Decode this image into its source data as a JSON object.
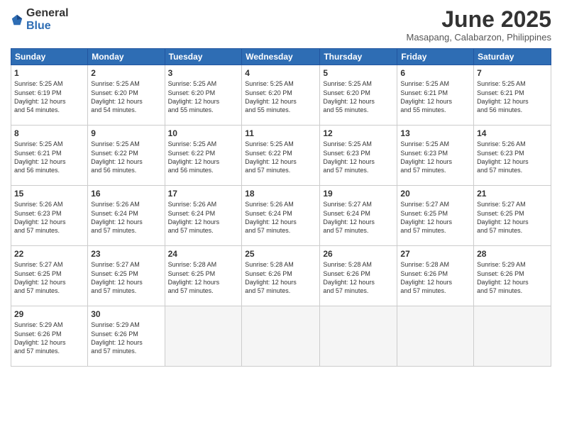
{
  "header": {
    "logo_general": "General",
    "logo_blue": "Blue",
    "month_title": "June 2025",
    "location": "Masapang, Calabarzon, Philippines"
  },
  "days_of_week": [
    "Sunday",
    "Monday",
    "Tuesday",
    "Wednesday",
    "Thursday",
    "Friday",
    "Saturday"
  ],
  "weeks": [
    [
      {
        "num": "1",
        "info": "Sunrise: 5:25 AM\nSunset: 6:19 PM\nDaylight: 12 hours\nand 54 minutes."
      },
      {
        "num": "2",
        "info": "Sunrise: 5:25 AM\nSunset: 6:20 PM\nDaylight: 12 hours\nand 54 minutes."
      },
      {
        "num": "3",
        "info": "Sunrise: 5:25 AM\nSunset: 6:20 PM\nDaylight: 12 hours\nand 55 minutes."
      },
      {
        "num": "4",
        "info": "Sunrise: 5:25 AM\nSunset: 6:20 PM\nDaylight: 12 hours\nand 55 minutes."
      },
      {
        "num": "5",
        "info": "Sunrise: 5:25 AM\nSunset: 6:20 PM\nDaylight: 12 hours\nand 55 minutes."
      },
      {
        "num": "6",
        "info": "Sunrise: 5:25 AM\nSunset: 6:21 PM\nDaylight: 12 hours\nand 55 minutes."
      },
      {
        "num": "7",
        "info": "Sunrise: 5:25 AM\nSunset: 6:21 PM\nDaylight: 12 hours\nand 56 minutes."
      }
    ],
    [
      {
        "num": "8",
        "info": "Sunrise: 5:25 AM\nSunset: 6:21 PM\nDaylight: 12 hours\nand 56 minutes."
      },
      {
        "num": "9",
        "info": "Sunrise: 5:25 AM\nSunset: 6:22 PM\nDaylight: 12 hours\nand 56 minutes."
      },
      {
        "num": "10",
        "info": "Sunrise: 5:25 AM\nSunset: 6:22 PM\nDaylight: 12 hours\nand 56 minutes."
      },
      {
        "num": "11",
        "info": "Sunrise: 5:25 AM\nSunset: 6:22 PM\nDaylight: 12 hours\nand 57 minutes."
      },
      {
        "num": "12",
        "info": "Sunrise: 5:25 AM\nSunset: 6:23 PM\nDaylight: 12 hours\nand 57 minutes."
      },
      {
        "num": "13",
        "info": "Sunrise: 5:25 AM\nSunset: 6:23 PM\nDaylight: 12 hours\nand 57 minutes."
      },
      {
        "num": "14",
        "info": "Sunrise: 5:26 AM\nSunset: 6:23 PM\nDaylight: 12 hours\nand 57 minutes."
      }
    ],
    [
      {
        "num": "15",
        "info": "Sunrise: 5:26 AM\nSunset: 6:23 PM\nDaylight: 12 hours\nand 57 minutes."
      },
      {
        "num": "16",
        "info": "Sunrise: 5:26 AM\nSunset: 6:24 PM\nDaylight: 12 hours\nand 57 minutes."
      },
      {
        "num": "17",
        "info": "Sunrise: 5:26 AM\nSunset: 6:24 PM\nDaylight: 12 hours\nand 57 minutes."
      },
      {
        "num": "18",
        "info": "Sunrise: 5:26 AM\nSunset: 6:24 PM\nDaylight: 12 hours\nand 57 minutes."
      },
      {
        "num": "19",
        "info": "Sunrise: 5:27 AM\nSunset: 6:24 PM\nDaylight: 12 hours\nand 57 minutes."
      },
      {
        "num": "20",
        "info": "Sunrise: 5:27 AM\nSunset: 6:25 PM\nDaylight: 12 hours\nand 57 minutes."
      },
      {
        "num": "21",
        "info": "Sunrise: 5:27 AM\nSunset: 6:25 PM\nDaylight: 12 hours\nand 57 minutes."
      }
    ],
    [
      {
        "num": "22",
        "info": "Sunrise: 5:27 AM\nSunset: 6:25 PM\nDaylight: 12 hours\nand 57 minutes."
      },
      {
        "num": "23",
        "info": "Sunrise: 5:27 AM\nSunset: 6:25 PM\nDaylight: 12 hours\nand 57 minutes."
      },
      {
        "num": "24",
        "info": "Sunrise: 5:28 AM\nSunset: 6:25 PM\nDaylight: 12 hours\nand 57 minutes."
      },
      {
        "num": "25",
        "info": "Sunrise: 5:28 AM\nSunset: 6:26 PM\nDaylight: 12 hours\nand 57 minutes."
      },
      {
        "num": "26",
        "info": "Sunrise: 5:28 AM\nSunset: 6:26 PM\nDaylight: 12 hours\nand 57 minutes."
      },
      {
        "num": "27",
        "info": "Sunrise: 5:28 AM\nSunset: 6:26 PM\nDaylight: 12 hours\nand 57 minutes."
      },
      {
        "num": "28",
        "info": "Sunrise: 5:29 AM\nSunset: 6:26 PM\nDaylight: 12 hours\nand 57 minutes."
      }
    ],
    [
      {
        "num": "29",
        "info": "Sunrise: 5:29 AM\nSunset: 6:26 PM\nDaylight: 12 hours\nand 57 minutes."
      },
      {
        "num": "30",
        "info": "Sunrise: 5:29 AM\nSunset: 6:26 PM\nDaylight: 12 hours\nand 57 minutes."
      },
      {
        "num": "",
        "info": ""
      },
      {
        "num": "",
        "info": ""
      },
      {
        "num": "",
        "info": ""
      },
      {
        "num": "",
        "info": ""
      },
      {
        "num": "",
        "info": ""
      }
    ]
  ]
}
